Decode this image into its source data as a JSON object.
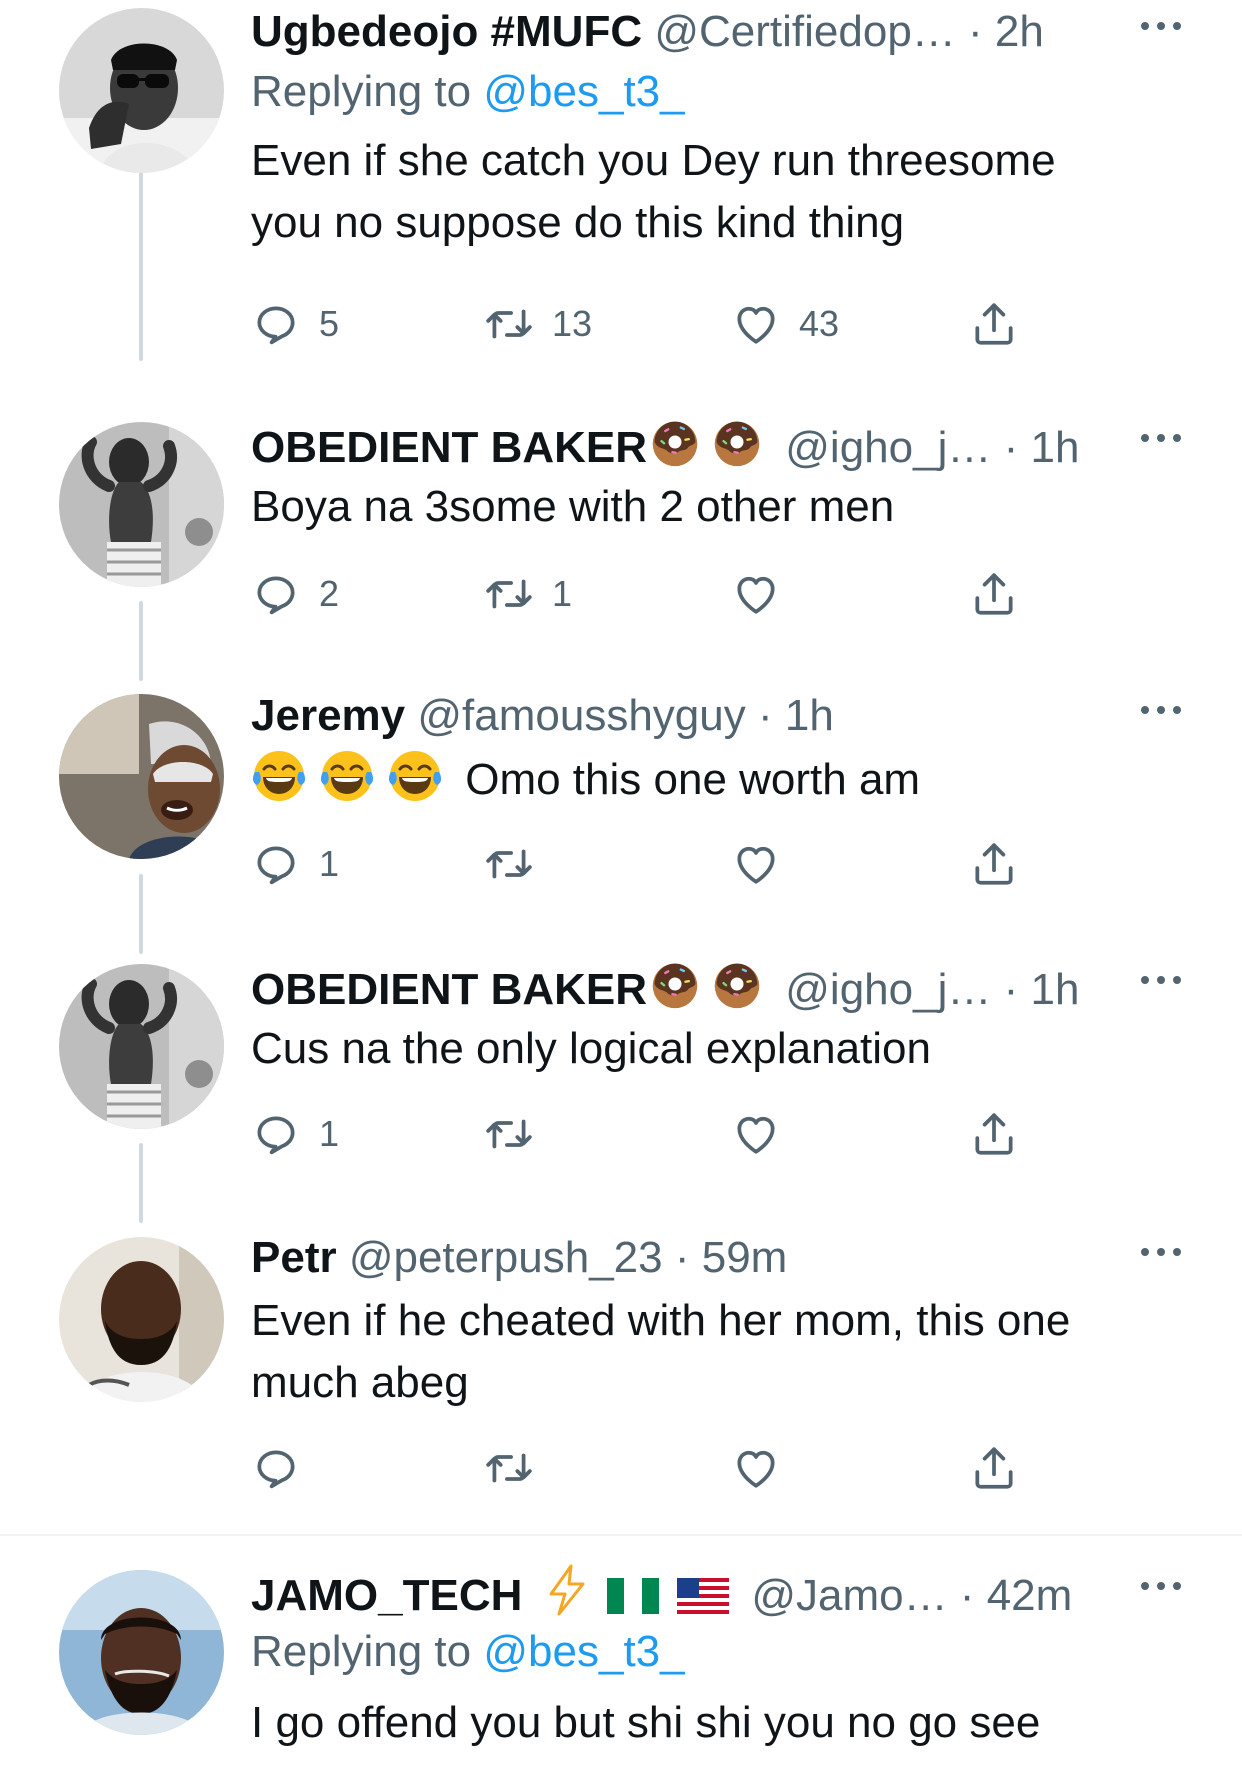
{
  "tweets": [
    {
      "name": "Ugbedeojo #MUFC",
      "handle": "@Certifiedop…",
      "sep": " · ",
      "time": "2h",
      "replying_prefix": "Replying to ",
      "replying_to": "@bes_t3_",
      "lines": [
        "Even if she catch you Dey run threesome",
        "you no suppose do this kind thing"
      ],
      "replies": "5",
      "retweets": "13",
      "likes": "43"
    },
    {
      "name": "OBEDIENT BAKER",
      "handle": "@igho_j…",
      "sep": " · ",
      "time": "1h",
      "name_emoji": "doughnut-emoji",
      "lines": [
        "Boya na 3some with 2 other men"
      ],
      "replies": "2",
      "retweets": "1",
      "likes": ""
    },
    {
      "name": "Jeremy",
      "handle": "@famousshyguy",
      "sep": " · ",
      "time": "1h",
      "body_emoji": "tears-of-joy-emoji",
      "lines": [
        "Omo this one worth am"
      ],
      "replies": "1",
      "retweets": "",
      "likes": ""
    },
    {
      "name": "OBEDIENT BAKER",
      "handle": "@igho_j…",
      "sep": " · ",
      "time": "1h",
      "name_emoji": "doughnut-emoji",
      "lines": [
        "Cus na the only logical explanation"
      ],
      "replies": "1",
      "retweets": "",
      "likes": ""
    },
    {
      "name": "Petr",
      "handle": "@peterpush_23",
      "sep": " · ",
      "time": "59m",
      "lines": [
        "Even if he cheated with her mom, this one",
        "much abeg"
      ],
      "replies": "",
      "retweets": "",
      "likes": ""
    },
    {
      "name": "JAMO_TECH",
      "handle": "@Jamo…",
      "sep": " · ",
      "time": "42m",
      "name_emoji": "lightning-nigeria-usa-flags",
      "replying_prefix": "Replying to ",
      "replying_to": "@bes_t3_",
      "lines": [
        "I go offend you but shi shi you no go see"
      ]
    }
  ],
  "colors": {
    "text": "#0f1419",
    "secondary": "#536471",
    "link": "#1d9bf0",
    "thread_line": "#cfd9de"
  },
  "icons": {
    "reply": "speech-bubble-icon",
    "retweet": "retweet-icon",
    "like": "heart-icon",
    "share": "share-icon",
    "more": "more-dots-icon"
  }
}
